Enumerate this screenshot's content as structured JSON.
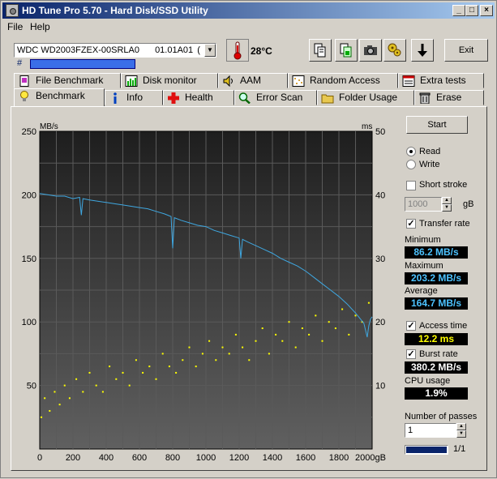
{
  "window": {
    "title": "HD Tune Pro 5.70 - Hard Disk/SSD Utility"
  },
  "menu": {
    "file": "File",
    "help": "Help"
  },
  "drive": {
    "model": "WDC WD2003FZEX-00SRLA0",
    "firmware": "01.01A01",
    "truncated_suffix": "(",
    "serial_label": "#"
  },
  "temperature": "28°C",
  "toolbar": {
    "exit": "Exit"
  },
  "tabs_top": [
    {
      "label": "File Benchmark",
      "icon": "file-benchmark-icon"
    },
    {
      "label": "Disk monitor",
      "icon": "disk-monitor-icon"
    },
    {
      "label": "AAM",
      "icon": "speaker-icon"
    },
    {
      "label": "Random Access",
      "icon": "random-access-icon"
    },
    {
      "label": "Extra tests",
      "icon": "extra-tests-icon"
    }
  ],
  "tabs_bottom": [
    {
      "label": "Benchmark",
      "icon": "lightbulb-icon",
      "active": true
    },
    {
      "label": "Info",
      "icon": "info-icon"
    },
    {
      "label": "Health",
      "icon": "health-cross-icon"
    },
    {
      "label": "Error Scan",
      "icon": "magnifier-icon"
    },
    {
      "label": "Folder Usage",
      "icon": "folder-icon"
    },
    {
      "label": "Erase",
      "icon": "trash-icon"
    }
  ],
  "controls": {
    "start": "Start",
    "read": "Read",
    "write": "Write",
    "mode": "read",
    "short_stroke": "Short stroke",
    "short_stroke_checked": false,
    "stroke_value": "1000",
    "stroke_unit": "gB",
    "transfer_rate": "Transfer rate",
    "transfer_rate_checked": true,
    "minimum_label": "Minimum",
    "minimum_value": "86.2 MB/s",
    "maximum_label": "Maximum",
    "maximum_value": "203.2 MB/s",
    "average_label": "Average",
    "average_value": "164.7 MB/s",
    "access_time": "Access time",
    "access_time_checked": true,
    "access_time_value": "12.2 ms",
    "burst_rate": "Burst rate",
    "burst_rate_checked": true,
    "burst_rate_value": "380.2 MB/s",
    "cpu_usage_label": "CPU usage",
    "cpu_usage_value": "1.9%",
    "passes_label": "Number of passes",
    "passes_value": "1",
    "progress_text": "1/1",
    "progress_fraction": 1.0
  },
  "chart_data": {
    "type": "line",
    "left_axis_label": "MB/s",
    "right_axis_label": "ms",
    "x_unit": "gB",
    "xlim": [
      0,
      2000
    ],
    "ylim_left": [
      0,
      250
    ],
    "ylim_right": [
      0,
      50
    ],
    "x_ticks": [
      0,
      200,
      400,
      600,
      800,
      1000,
      1200,
      1400,
      1600,
      1800,
      2000
    ],
    "x_tick_labels": [
      "0",
      "200",
      "400",
      "600",
      "800",
      "1000",
      "1200",
      "1400",
      "1600",
      "1800",
      "2000gB"
    ],
    "y_left_ticks": [
      0,
      50,
      100,
      150,
      200,
      250
    ],
    "y_left_tick_labels": [
      "",
      "50",
      "100",
      "150",
      "200",
      "250"
    ],
    "y_right_ticks": [
      0,
      10,
      20,
      30,
      40,
      50
    ],
    "y_right_tick_labels": [
      "",
      "10",
      "20",
      "30",
      "40",
      "50"
    ],
    "grid": true,
    "series": [
      {
        "axis": "left",
        "color": "#3fa7e0",
        "x": [
          0,
          50,
          100,
          150,
          200,
          240,
          250,
          260,
          300,
          400,
          450,
          500,
          550,
          600,
          650,
          700,
          750,
          790,
          800,
          810,
          850,
          900,
          950,
          1000,
          1050,
          1100,
          1150,
          1200,
          1210,
          1220,
          1250,
          1300,
          1350,
          1400,
          1450,
          1500,
          1550,
          1600,
          1650,
          1700,
          1750,
          1800,
          1850,
          1900,
          1950,
          1970,
          1980,
          1990,
          2000
        ],
        "y": [
          201,
          200,
          199,
          199,
          197,
          198,
          184,
          197,
          196,
          194,
          193,
          192,
          191,
          190,
          189,
          187,
          185,
          183,
          158,
          182,
          180,
          178,
          176,
          175,
          172,
          170,
          168,
          166,
          150,
          165,
          163,
          160,
          157,
          154,
          150,
          147,
          144,
          140,
          135,
          130,
          125,
          120,
          114,
          107,
          99,
          88,
          97,
          102,
          104
        ]
      },
      {
        "axis": "right",
        "type": "scatter",
        "color": "#ffff00",
        "x": [
          10,
          30,
          60,
          90,
          120,
          150,
          180,
          220,
          260,
          300,
          340,
          380,
          420,
          460,
          500,
          540,
          580,
          620,
          660,
          700,
          740,
          780,
          820,
          860,
          900,
          940,
          980,
          1020,
          1060,
          1100,
          1140,
          1180,
          1220,
          1260,
          1300,
          1340,
          1380,
          1420,
          1460,
          1500,
          1540,
          1580,
          1620,
          1660,
          1700,
          1740,
          1780,
          1820,
          1860,
          1900,
          1940,
          1980
        ],
        "y": [
          5,
          8,
          6,
          9,
          7,
          10,
          8,
          11,
          9,
          12,
          10,
          9,
          13,
          11,
          12,
          10,
          14,
          12,
          13,
          11,
          15,
          13,
          12,
          14,
          16,
          13,
          15,
          17,
          14,
          16,
          15,
          18,
          16,
          14,
          17,
          19,
          15,
          18,
          17,
          20,
          16,
          19,
          18,
          21,
          17,
          20,
          19,
          22,
          18,
          21,
          20,
          23
        ]
      }
    ]
  }
}
